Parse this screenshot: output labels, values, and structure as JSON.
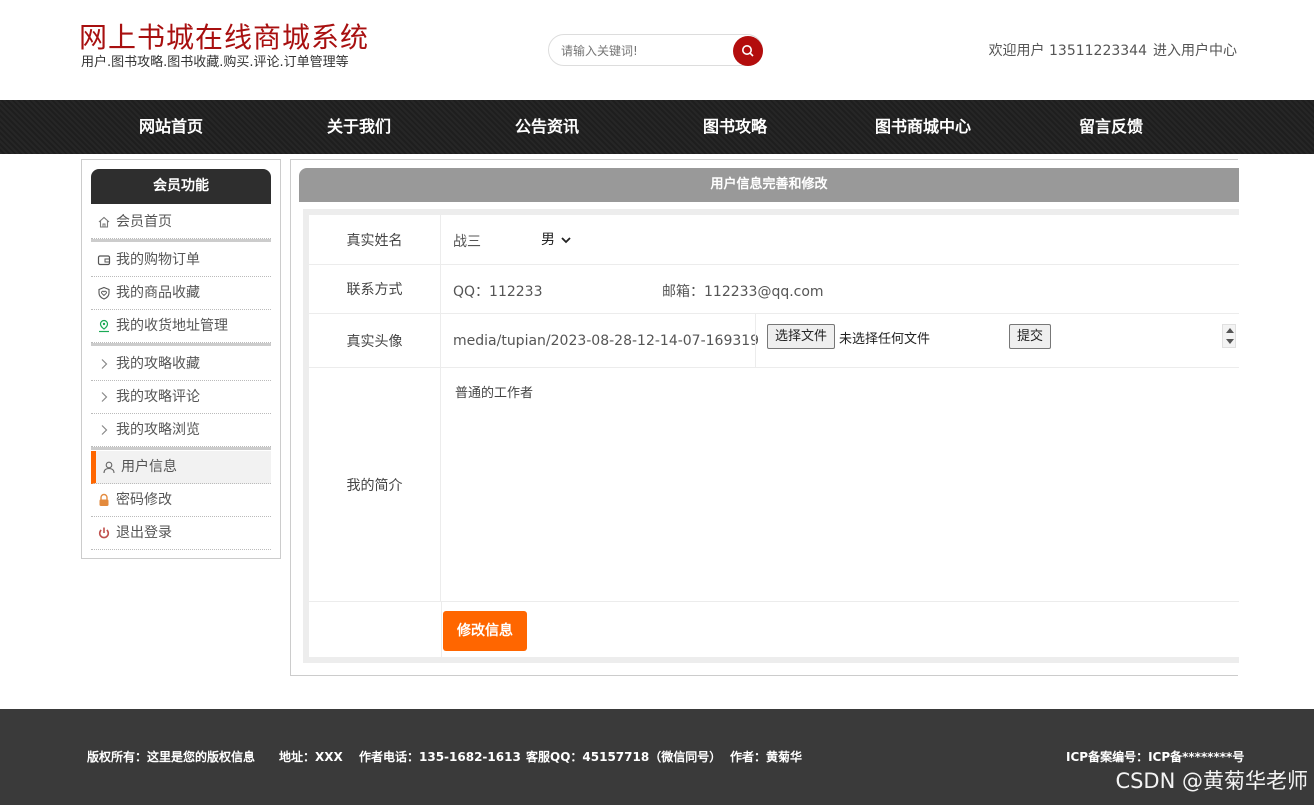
{
  "header": {
    "title": "网上书城在线商城系统",
    "subtitle": "用户.图书攻略.图书收藏.购买.评论.订单管理等",
    "search_placeholder": "请输入关键词!",
    "welcome_prefix": "欢迎用户 13511223344",
    "user_center": "进入用户中心"
  },
  "nav": [
    "网站首页",
    "关于我们",
    "公告资讯",
    "图书攻略",
    "图书商城中心",
    "留言反馈"
  ],
  "sidebar": {
    "title": "会员功能",
    "items": [
      {
        "label": "会员首页",
        "icon": "home-icon"
      },
      {
        "label": "我的购物订单",
        "icon": "wallet-icon"
      },
      {
        "label": "我的商品收藏",
        "icon": "shield-heart-icon"
      },
      {
        "label": "我的收货地址管理",
        "icon": "location-icon"
      },
      {
        "label": "我的攻略收藏",
        "icon": "chevron-right-icon"
      },
      {
        "label": "我的攻略评论",
        "icon": "chevron-right-icon"
      },
      {
        "label": "我的攻略浏览",
        "icon": "chevron-right-icon"
      },
      {
        "label": "用户信息",
        "icon": "user-icon"
      },
      {
        "label": "密码修改",
        "icon": "lock-icon"
      },
      {
        "label": "退出登录",
        "icon": "power-icon"
      }
    ]
  },
  "form": {
    "title": "用户信息完善和修改",
    "name_label": "真实姓名",
    "name_value": "战三",
    "gender_value": "男",
    "contact_label": "联系方式",
    "qq_value": "QQ：112233",
    "email_value": "邮箱：112233@qq.com",
    "avatar_label": "真实头像",
    "avatar_path": "media/tupian/2023-08-28-12-14-07-169319",
    "choose_file": "选择文件",
    "no_file": "未选择任何文件",
    "submit": "提交",
    "bio_label": "我的简介",
    "bio_value": "普通的工作者",
    "save_button": "修改信息"
  },
  "footer": {
    "copyright": "版权所有：这里是您的版权信息",
    "address": "地址：XXX",
    "phone": "作者电话：135-1682-1613",
    "qq": "客服QQ：45157718（微信同号）",
    "author": "作者：黄菊华",
    "icp": "ICP备案编号：ICP备********号",
    "watermark": "CSDN @黄菊华老师"
  },
  "colors": {
    "brand_red": "#a81010",
    "accent_orange": "#ff6600",
    "nav_bg": "#222222",
    "footer_bg": "#3a3a3a"
  }
}
